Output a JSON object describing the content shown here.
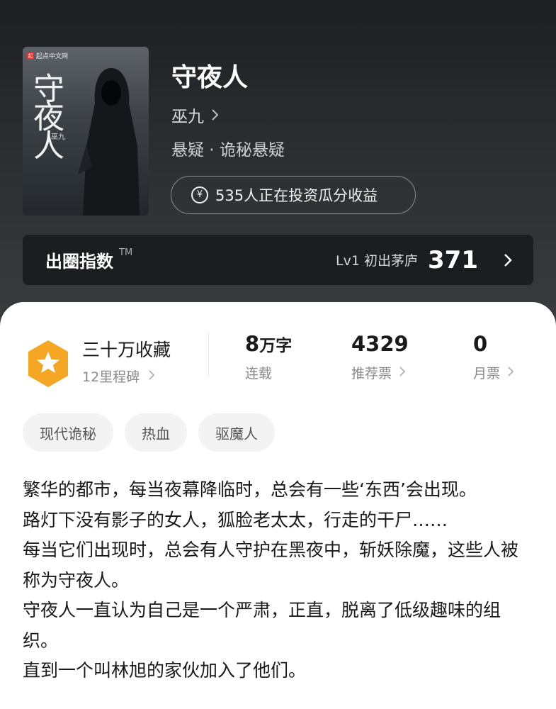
{
  "cover": {
    "publisher": "起点中文网",
    "publisher_mark": "起",
    "title": "守夜人",
    "author": "巫九"
  },
  "book": {
    "title": "守夜人",
    "author": "巫九",
    "genre": "悬疑 · 诡秘悬疑",
    "invest_icon": "¥",
    "invest_text": "535人正在投资瓜分收益"
  },
  "index": {
    "label": "出圈指数",
    "tm": "TM",
    "level": "Lv1 初出茅庐",
    "score": "371"
  },
  "stats": {
    "collection_title": "三十万收藏",
    "collection_sub": "12里程碑",
    "words_num": "8",
    "words_unit": "万字",
    "words_label": "连载",
    "recommend_num": "4329",
    "recommend_label": "推荐票",
    "monthly_num": "0",
    "monthly_label": "月票"
  },
  "tags": [
    "现代诡秘",
    "热血",
    "驱魔人"
  ],
  "synopsis": [
    "繁华的都市，每当夜幕降临时，总会有一些‘东西’会出现。",
    "路灯下没有影子的女人，狐脸老太太，行走的干尸……",
    "每当它们出现时，总会有人守护在黑夜中，斩妖除魔，这些人被称为守夜人。",
    "守夜人一直认为自己是一个严肃，正直，脱离了低级趣味的组织。",
    "直到一个叫林旭的家伙加入了他们。"
  ],
  "colors": {
    "accent": "#f5a623",
    "hero_bg": "#2f3034",
    "index_bg": "#1c1d20"
  }
}
